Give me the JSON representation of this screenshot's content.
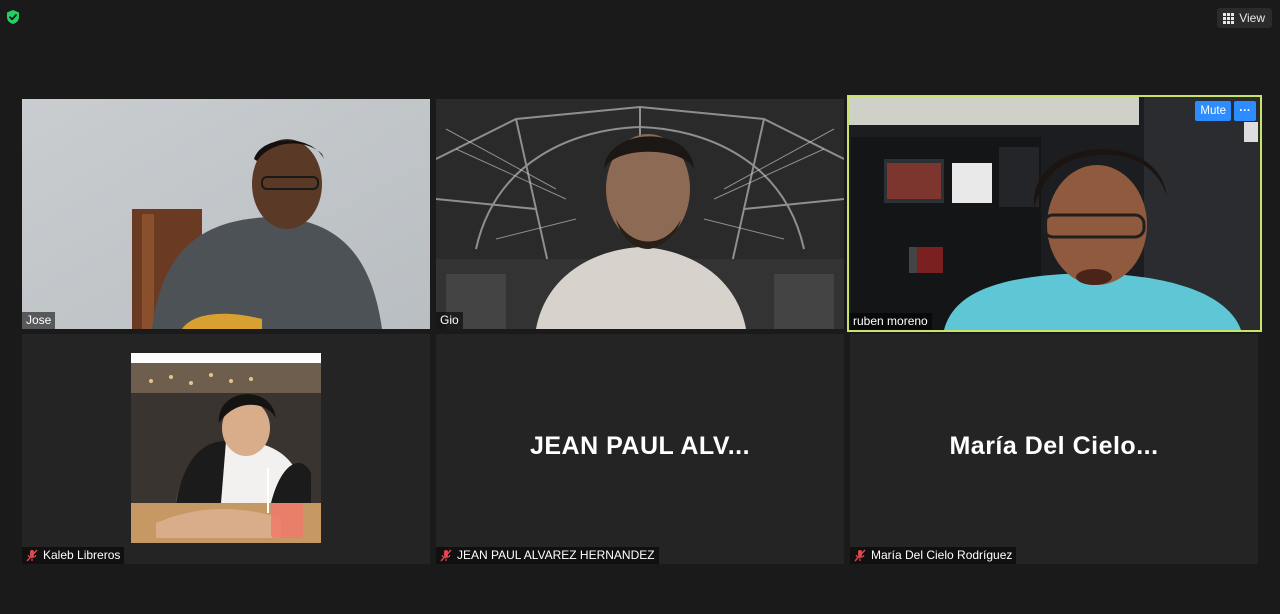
{
  "toolbar": {
    "security_icon": "shield-check-icon",
    "view_label": "View",
    "view_icon": "grid-icon"
  },
  "participants": [
    {
      "name": "Jose",
      "muted": false,
      "video": true
    },
    {
      "name": "Gio",
      "muted": false,
      "video": true
    },
    {
      "name": "ruben moreno",
      "muted": false,
      "video": true,
      "active_speaker": true
    },
    {
      "name": "Kaleb Libreros",
      "muted": true,
      "video": false,
      "avatar": true
    },
    {
      "name": "JEAN PAUL ALVAREZ HERNANDEZ",
      "display": "JEAN PAUL ALV...",
      "muted": true,
      "video": false
    },
    {
      "name": "María Del Cielo Rodríguez",
      "display": "María Del Cielo...",
      "muted": true,
      "video": false
    }
  ],
  "active_tile_controls": {
    "mute_label": "Mute",
    "more_label": "···"
  },
  "colors": {
    "background": "#1a1a1a",
    "tile": "#242424",
    "active_border": "#c7e36a",
    "accent": "#2d8cff",
    "muted_icon": "#e0474c",
    "shield": "#23d160"
  }
}
